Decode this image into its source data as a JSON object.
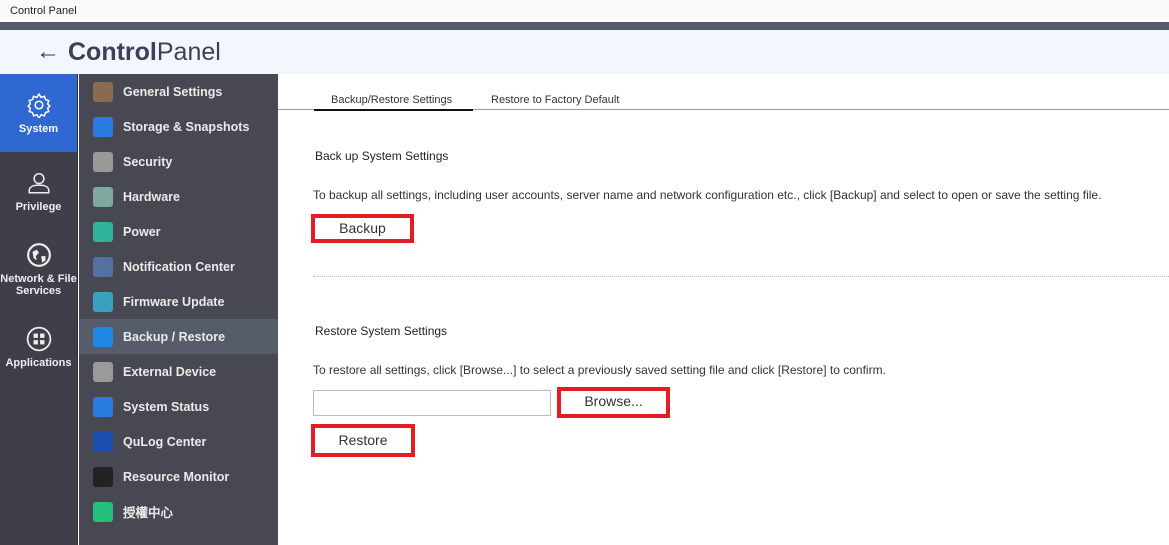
{
  "window": {
    "title": "Control Panel"
  },
  "header": {
    "title_bold": "Control",
    "title_light": "Panel"
  },
  "rail": [
    {
      "label": "System"
    },
    {
      "label": "Privilege"
    },
    {
      "label": "Network & File Services"
    },
    {
      "label": "Applications"
    }
  ],
  "submenu": [
    {
      "label": "General Settings",
      "color": "#8a6a50"
    },
    {
      "label": "Storage & Snapshots",
      "color": "#2a7be0"
    },
    {
      "label": "Security",
      "color": "#999999"
    },
    {
      "label": "Hardware",
      "color": "#7fa8a0"
    },
    {
      "label": "Power",
      "color": "#2fb39a"
    },
    {
      "label": "Notification Center",
      "color": "#5570a0"
    },
    {
      "label": "Firmware Update",
      "color": "#3aa0c0"
    },
    {
      "label": "Backup / Restore",
      "color": "#1e88e5"
    },
    {
      "label": "External Device",
      "color": "#9a9a9a"
    },
    {
      "label": "System Status",
      "color": "#2a7be0"
    },
    {
      "label": "QuLog Center",
      "color": "#1a4fb0"
    },
    {
      "label": "Resource Monitor",
      "color": "#222222"
    },
    {
      "label": "授權中心",
      "color": "#22c07a"
    }
  ],
  "tabs": [
    "Backup/Restore Settings",
    "Restore to Factory Default"
  ],
  "backup": {
    "heading": "Back up System Settings",
    "desc": "To backup all settings, including user accounts, server name and network configuration etc., click [Backup] and select to open or save the setting file.",
    "button": "Backup"
  },
  "restore": {
    "heading": "Restore System Settings",
    "desc": "To restore all settings, click [Browse...] to select a previously saved setting file and click [Restore] to confirm.",
    "file_value": "",
    "browse": "Browse...",
    "button": "Restore"
  }
}
